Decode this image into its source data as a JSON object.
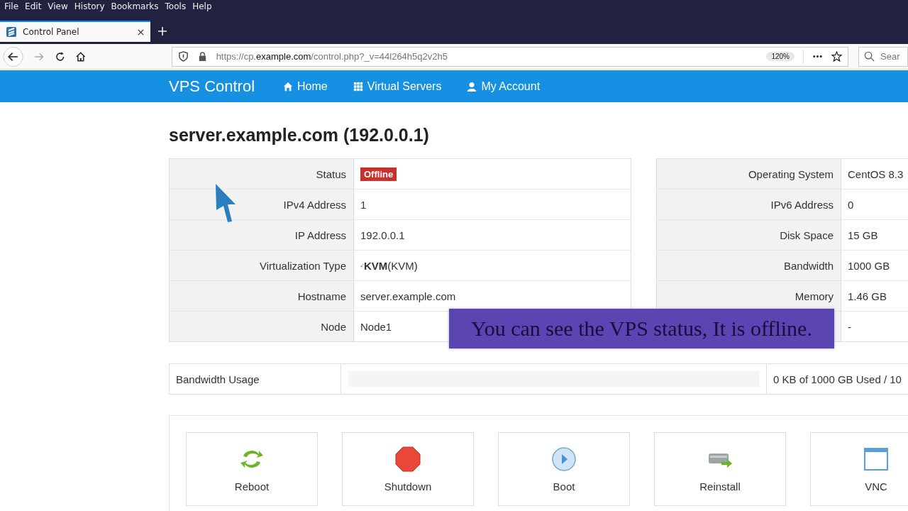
{
  "menu_bar": [
    "File",
    "Edit",
    "View",
    "History",
    "Bookmarks",
    "Tools",
    "Help"
  ],
  "tab": {
    "title": "Control Panel",
    "selected": true
  },
  "address_bar": {
    "url_prefix": "https://cp.",
    "url_domain": "example.com",
    "url_rest": "/control.php?_v=44l264h5q2v2h5",
    "zoom": "120%",
    "search_placeholder": "Sear"
  },
  "navbar": {
    "brand": "VPS Control",
    "links": [
      {
        "label": "Home"
      },
      {
        "label": "Virtual Servers"
      },
      {
        "label": "My Account"
      }
    ]
  },
  "title": "server.example.com (192.0.0.1)",
  "details_left": [
    {
      "label": "Status",
      "value": "Offline",
      "kind": "badge"
    },
    {
      "label": "IPv4 Address",
      "value": "1",
      "kind": "text"
    },
    {
      "label": "IP Address",
      "value": "192.0.0.1",
      "kind": "text"
    },
    {
      "label": "Virtualization Type",
      "value": "**KVM**(KVM)",
      "kind": "icon-text"
    },
    {
      "label": "Hostname",
      "value": "server.example.com",
      "kind": "text"
    },
    {
      "label": "Node",
      "value": "Node1",
      "kind": "text"
    }
  ],
  "details_right": [
    {
      "label": "Operating System",
      "value": "CentOS 8.3"
    },
    {
      "label": "IPv6 Address",
      "value": "0"
    },
    {
      "label": "Disk Space",
      "value": "15 GB"
    },
    {
      "label": "Bandwidth",
      "value": "1000 GB"
    },
    {
      "label": "Memory",
      "value": "1.46 GB"
    },
    {
      "value": "-"
    }
  ],
  "bandwidth_usage": {
    "label": "Bandwidth Usage",
    "level": 0,
    "reading": "0 KB of 1000 GB Used / 10"
  },
  "actions": [
    {
      "label": "Reboot"
    },
    {
      "label": "Shutdown"
    },
    {
      "label": "Boot"
    },
    {
      "label": "Reinstall"
    },
    {
      "label": "VNC"
    }
  ],
  "caption": "You can see the VPS status, It is offline."
}
